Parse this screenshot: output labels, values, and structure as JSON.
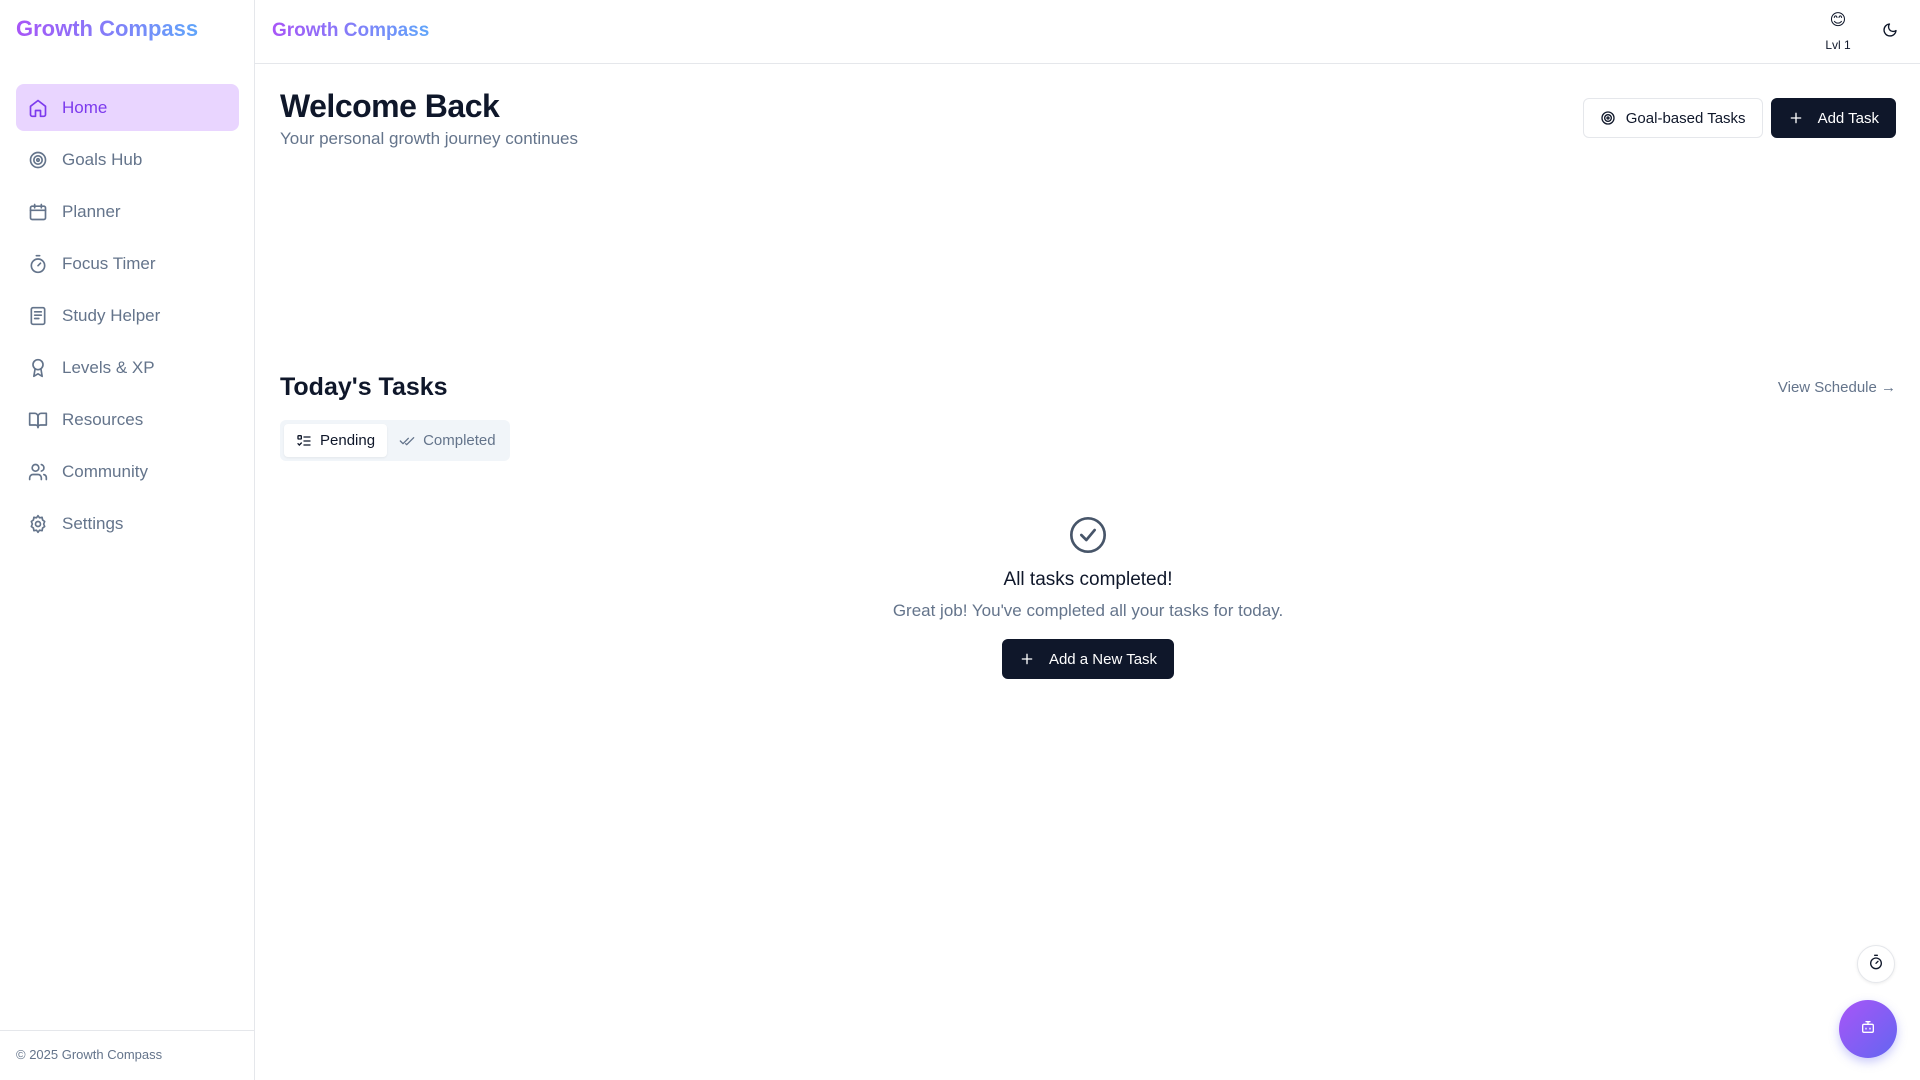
{
  "app": {
    "name": "Growth Compass"
  },
  "sidebar": {
    "brand": "Growth Compass",
    "items": [
      {
        "label": "Home",
        "icon": "home-icon",
        "active": true
      },
      {
        "label": "Goals Hub",
        "icon": "target-icon"
      },
      {
        "label": "Planner",
        "icon": "calendar-icon"
      },
      {
        "label": "Focus Timer",
        "icon": "timer-icon"
      },
      {
        "label": "Study Helper",
        "icon": "notebook-icon"
      },
      {
        "label": "Levels & XP",
        "icon": "award-icon"
      },
      {
        "label": "Resources",
        "icon": "book-icon"
      },
      {
        "label": "Community",
        "icon": "users-icon"
      },
      {
        "label": "Settings",
        "icon": "gear-icon"
      }
    ],
    "footer": "© 2025 Growth Compass"
  },
  "topbar": {
    "brand": "Growth Compass",
    "level_emoji": "😊",
    "level_label": "Lvl 1",
    "theme_icon": "moon-icon"
  },
  "header": {
    "title": "Welcome Back",
    "subtitle": "Your personal growth journey continues",
    "goal_tasks_label": "Goal-based Tasks",
    "add_task_label": "Add Task"
  },
  "tasks": {
    "title": "Today's Tasks",
    "view_schedule": "View Schedule →",
    "tabs": [
      {
        "label": "Pending",
        "active": true
      },
      {
        "label": "Completed",
        "active": false
      }
    ],
    "empty_title": "All tasks completed!",
    "empty_subtitle": "Great job! You've completed all your tasks for today.",
    "empty_button": "Add a New Task"
  },
  "colors": {
    "accent": "#7c3aed",
    "active_bg": "#e9d5ff",
    "dark_button": "#0f172a",
    "muted_text": "#64748b"
  }
}
